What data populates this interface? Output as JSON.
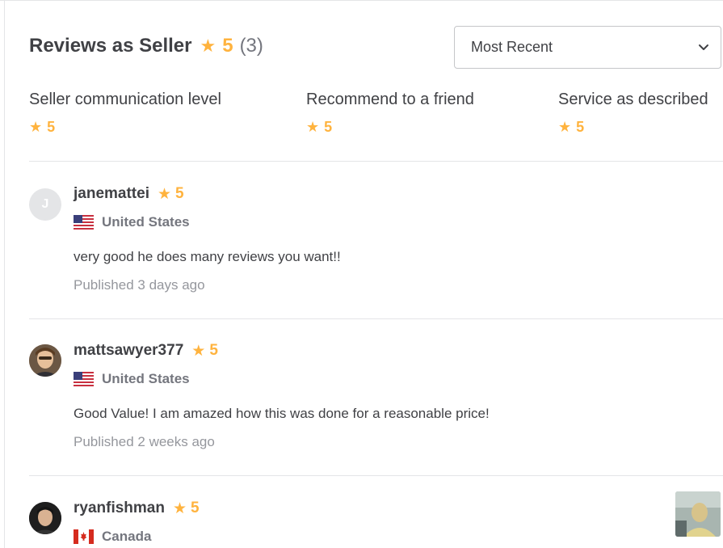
{
  "header": {
    "title": "Reviews as Seller",
    "score": "5",
    "count": "(3)"
  },
  "sort": {
    "selected": "Most Recent"
  },
  "breakdown": [
    {
      "label": "Seller communication level",
      "rating": "5"
    },
    {
      "label": "Recommend to a friend",
      "rating": "5"
    },
    {
      "label": "Service as described",
      "rating": "5"
    }
  ],
  "reviews": [
    {
      "avatar_letter": "J",
      "username": "janemattei",
      "rating": "5",
      "country": "United States",
      "text": "very good he does many reviews you want!!",
      "published": "Published 3 days ago"
    },
    {
      "username": "mattsawyer377",
      "rating": "5",
      "country": "United States",
      "text": "Good Value! I am amazed how this was done for a reasonable price!",
      "published": "Published 2 weeks ago"
    },
    {
      "username": "ryanfishman",
      "rating": "5",
      "country": "Canada"
    }
  ],
  "colors": {
    "star": "#ffb33e",
    "text": "#404145",
    "muted": "#74767e",
    "divider": "#e4e5e7"
  }
}
